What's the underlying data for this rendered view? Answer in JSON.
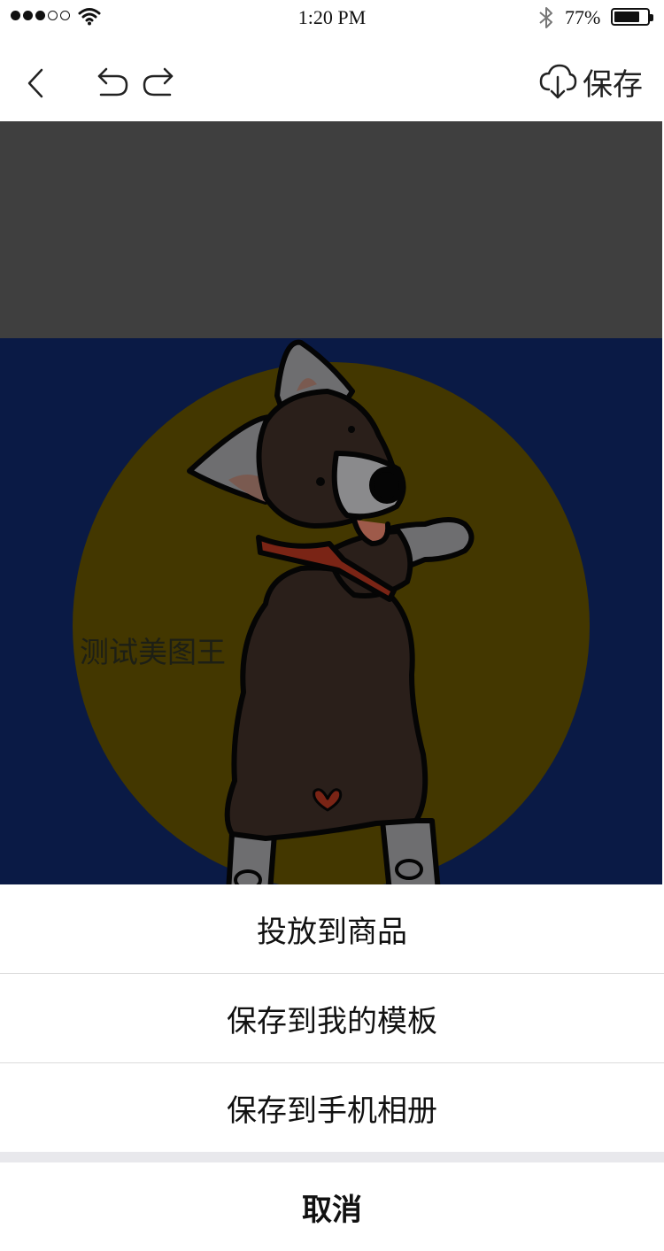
{
  "status_bar": {
    "time": "1:20 PM",
    "battery_percent": "77%",
    "battery_level": 0.77,
    "signal_bars_filled": 3,
    "signal_bars_total": 5
  },
  "nav": {
    "back_icon": "chevron-left-icon",
    "undo_icon": "undo-icon",
    "redo_icon": "redo-icon",
    "save_icon": "cloud-download-icon",
    "save_label": "保存"
  },
  "canvas": {
    "overlay_text": "测试美图王"
  },
  "action_sheet": {
    "items": [
      "投放到商品",
      "保存到我的模板",
      "保存到手机相册"
    ],
    "cancel_label": "取消"
  },
  "colors": {
    "poster_background": "#0a1a45",
    "sun": "#433700",
    "dog_body": "#2a1f1a",
    "collar": "#7a2415",
    "canvas_background": "#3f3f3f"
  }
}
